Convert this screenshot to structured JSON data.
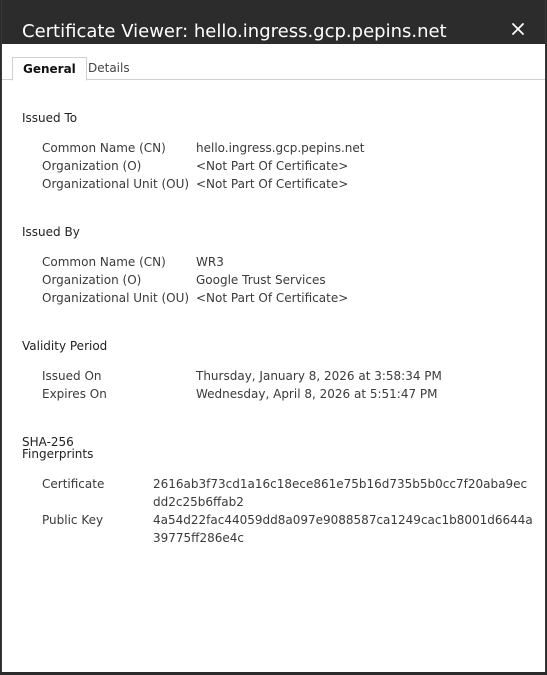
{
  "window": {
    "title": "Certificate Viewer: hello.ingress.gcp.pepins.net",
    "close_glyph": "✕"
  },
  "tabs": [
    {
      "label": "General",
      "active": true
    },
    {
      "label": "Details",
      "active": false
    }
  ],
  "issued_to": {
    "heading": "Issued To",
    "rows": [
      {
        "label": "Common Name (CN)",
        "value": "hello.ingress.gcp.pepins.net"
      },
      {
        "label": "Organization (O)",
        "value": "<Not Part Of Certificate>"
      },
      {
        "label": "Organizational Unit (OU)",
        "value": "<Not Part Of Certificate>"
      }
    ]
  },
  "issued_by": {
    "heading": "Issued By",
    "rows": [
      {
        "label": "Common Name (CN)",
        "value": "WR3"
      },
      {
        "label": "Organization (O)",
        "value": "Google Trust Services"
      },
      {
        "label": "Organizational Unit (OU)",
        "value": "<Not Part Of Certificate>"
      }
    ]
  },
  "validity": {
    "heading": "Validity Period",
    "rows": [
      {
        "label": "Issued On",
        "value": "Thursday, January 8, 2026 at 3:58:34 PM"
      },
      {
        "label": "Expires On",
        "value": "Wednesday, April 8, 2026 at 5:51:47 PM"
      }
    ]
  },
  "fingerprints": {
    "heading_line1": "SHA-256",
    "heading_line2": "Fingerprints",
    "rows": [
      {
        "label": "Certificate",
        "value": "2616ab3f73cd1a16c18ece861e75b16d735b5b0cc7f20aba9ecdd2c25b6ffab2"
      },
      {
        "label": "Public Key",
        "value": "4a54d22fac44059dd8a097e9088587ca1249cac1b8001d6644a39775ff286e4c"
      }
    ]
  },
  "colors": {
    "titlebar": "#2c2c2c",
    "background": "#ffffff",
    "text": "#3a3a3a"
  }
}
